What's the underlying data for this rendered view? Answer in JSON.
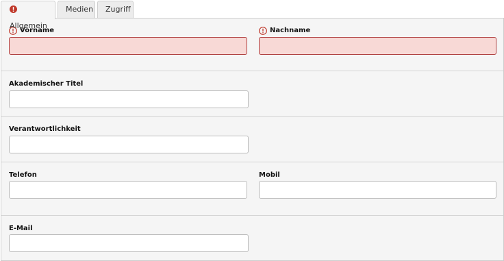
{
  "tabs": [
    {
      "label": "Allgemein",
      "active": true,
      "has_error": true
    },
    {
      "label": "Medien",
      "active": false,
      "has_error": false
    },
    {
      "label": "Zugriff",
      "active": false,
      "has_error": false
    }
  ],
  "fields": {
    "vorname": {
      "label": "Vorname",
      "value": "",
      "required_error": true
    },
    "nachname": {
      "label": "Nachname",
      "value": "",
      "required_error": true
    },
    "akademischer_titel": {
      "label": "Akademischer Titel",
      "value": ""
    },
    "verantwortlichkeit": {
      "label": "Verantwortlichkeit",
      "value": ""
    },
    "telefon": {
      "label": "Telefon",
      "value": ""
    },
    "mobil": {
      "label": "Mobil",
      "value": ""
    },
    "email": {
      "label": "E-Mail",
      "value": ""
    }
  },
  "colors": {
    "error": "#c0392b",
    "invalid_field_bg": "#f8d9d6",
    "panel_bg": "#f5f5f5"
  },
  "icons": {
    "tab_error": "exclamation-circle-filled",
    "field_error": "exclamation-circle-outline"
  }
}
